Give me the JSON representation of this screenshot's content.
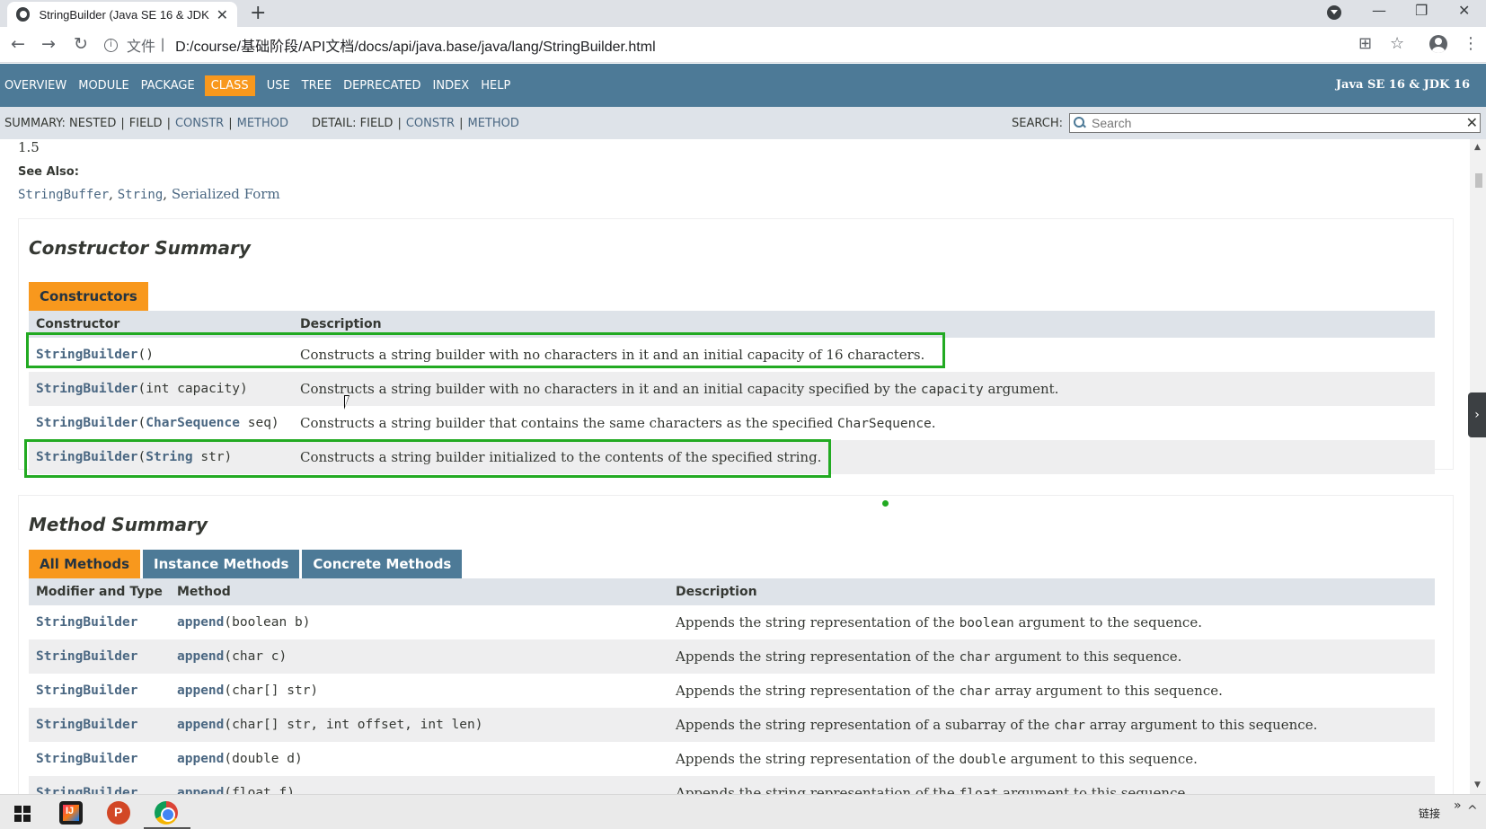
{
  "browser": {
    "tab_title": "StringBuilder (Java SE 16 & JDK 16)",
    "tab_close": "✕",
    "new_tab": "+",
    "url_file_label": "文件",
    "url": "D:/course/基础阶段/API文档/docs/api/java.base/java/lang/StringBuilder.html",
    "back": "←",
    "forward": "→",
    "reload": "↻",
    "minimize": "—",
    "restore": "❐",
    "close": "✕",
    "translate": "⊞",
    "bookmark": "☆",
    "menu": "⋮"
  },
  "javadoc_nav": {
    "items": [
      "OVERVIEW",
      "MODULE",
      "PACKAGE",
      "CLASS",
      "USE",
      "TREE",
      "DEPRECATED",
      "INDEX",
      "HELP"
    ],
    "active": "CLASS",
    "about": "Java SE 16 & JDK 16"
  },
  "subnav": {
    "summary_label": "SUMMARY:",
    "summary_nested": "NESTED",
    "summary_field": "FIELD",
    "summary_constr": "CONSTR",
    "summary_method": "METHOD",
    "detail_label": "DETAIL:",
    "detail_field": "FIELD",
    "detail_constr": "CONSTR",
    "detail_method": "METHOD",
    "pipe": "|",
    "search_label": "SEARCH:",
    "search_placeholder": "Search",
    "search_reset": "✕"
  },
  "since": {
    "value": "1.5"
  },
  "see_also": {
    "label": "See Also:",
    "links": [
      "StringBuffer",
      "String",
      "Serialized Form"
    ],
    "comma": ","
  },
  "constructor_summary": {
    "title": "Constructor Summary",
    "caption": "Constructors",
    "headers": [
      "Constructor",
      "Description"
    ],
    "rows": [
      {
        "name": "StringBuilder",
        "params": "()",
        "desc": "Constructs a string builder with no characters in it and an initial capacity of 16 characters.",
        "highlighted": true
      },
      {
        "name": "StringBuilder",
        "params": "(int capacity)",
        "desc_pre": "Constructs a string builder with no characters in it and an initial capacity specified by the ",
        "desc_code": "capacity",
        "desc_post": " argument.",
        "highlighted": false
      },
      {
        "name": "StringBuilder",
        "params_open": "(",
        "params_link": "CharSequence",
        "params_close": " seq)",
        "desc_pre": "Constructs a string builder that contains the same characters as the specified ",
        "desc_code": "CharSequence",
        "desc_post": ".",
        "highlighted": false
      },
      {
        "name": "StringBuilder",
        "params_open": "(",
        "params_link": "String",
        "params_close": " str)",
        "desc": "Constructs a string builder initialized to the contents of the specified string.",
        "highlighted": true
      }
    ]
  },
  "method_summary": {
    "title": "Method Summary",
    "tabs": [
      "All Methods",
      "Instance Methods",
      "Concrete Methods"
    ],
    "active_tab": "All Methods",
    "headers": [
      "Modifier and Type",
      "Method",
      "Description"
    ],
    "rows": [
      {
        "type": "StringBuilder",
        "method": "append",
        "params": "(boolean b)",
        "desc_pre": "Appends the string representation of the ",
        "desc_code": "boolean",
        "desc_post": " argument to the sequence."
      },
      {
        "type": "StringBuilder",
        "method": "append",
        "params": "(char c)",
        "desc_pre": "Appends the string representation of the ",
        "desc_code": "char",
        "desc_post": " argument to this sequence."
      },
      {
        "type": "StringBuilder",
        "method": "append",
        "params": "(char[] str)",
        "desc_pre": "Appends the string representation of the ",
        "desc_code": "char",
        "desc_post": " array argument to this sequence."
      },
      {
        "type": "StringBuilder",
        "method": "append",
        "params": "(char[] str, int offset, int len)",
        "desc_pre": "Appends the string representation of a subarray of the ",
        "desc_code": "char",
        "desc_post": " array argument to this sequence."
      },
      {
        "type": "StringBuilder",
        "method": "append",
        "params": "(double d)",
        "desc_pre": "Appends the string representation of the ",
        "desc_code": "double",
        "desc_post": " argument to this sequence."
      },
      {
        "type": "StringBuilder",
        "method": "append",
        "params": "(float f)",
        "desc_pre": "Appends the string representation of the ",
        "desc_code": "float",
        "desc_post": " argument to this sequence."
      }
    ]
  },
  "scrollbar": {
    "up": "▲",
    "down": "▼"
  },
  "side_panel": {
    "arrow": "›"
  },
  "taskbar": {
    "links_label": "链接",
    "expand": "»",
    "chevron": "^"
  },
  "colors": {
    "nav_bg": "#4d7a97",
    "nav_active": "#f8981d",
    "subnav_bg": "#dee3e9",
    "link": "#4a6782",
    "highlight_box": "#22aa22"
  }
}
